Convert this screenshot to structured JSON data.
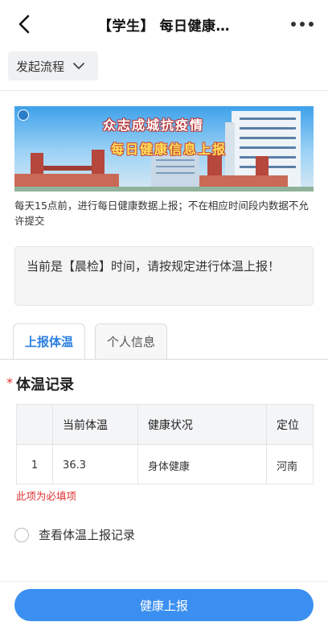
{
  "header": {
    "title": "【学生】 每日健康…",
    "back_icon": "chevron-left-icon",
    "more_icon": "more-dots-icon"
  },
  "flow": {
    "label": "发起流程",
    "icon": "chevron-down-icon"
  },
  "banner": {
    "line1": "众志成城抗疫情",
    "line2": "每日健康信息上报"
  },
  "notice": "每天15点前，进行每日健康数据上报；不在相应时间段内数据不允许提交",
  "alert": "当前是【晨检】时间，请按规定进行体温上报！",
  "tabs": [
    {
      "label": "上报体温",
      "active": true
    },
    {
      "label": "个人信息",
      "active": false
    }
  ],
  "section": {
    "required_mark": "*",
    "title": "体温记录"
  },
  "table": {
    "columns": [
      "",
      "当前体温",
      "健康状况",
      "定位"
    ],
    "rows": [
      [
        "1",
        "36.3",
        "身体健康",
        "河南"
      ]
    ]
  },
  "required_hint": "此项为必填项",
  "view_records_label": "查看体温上报记录",
  "submit_label": "健康上报",
  "colors": {
    "accent": "#2c7fe0",
    "button": "#3b8ff0",
    "required": "#e03131"
  }
}
